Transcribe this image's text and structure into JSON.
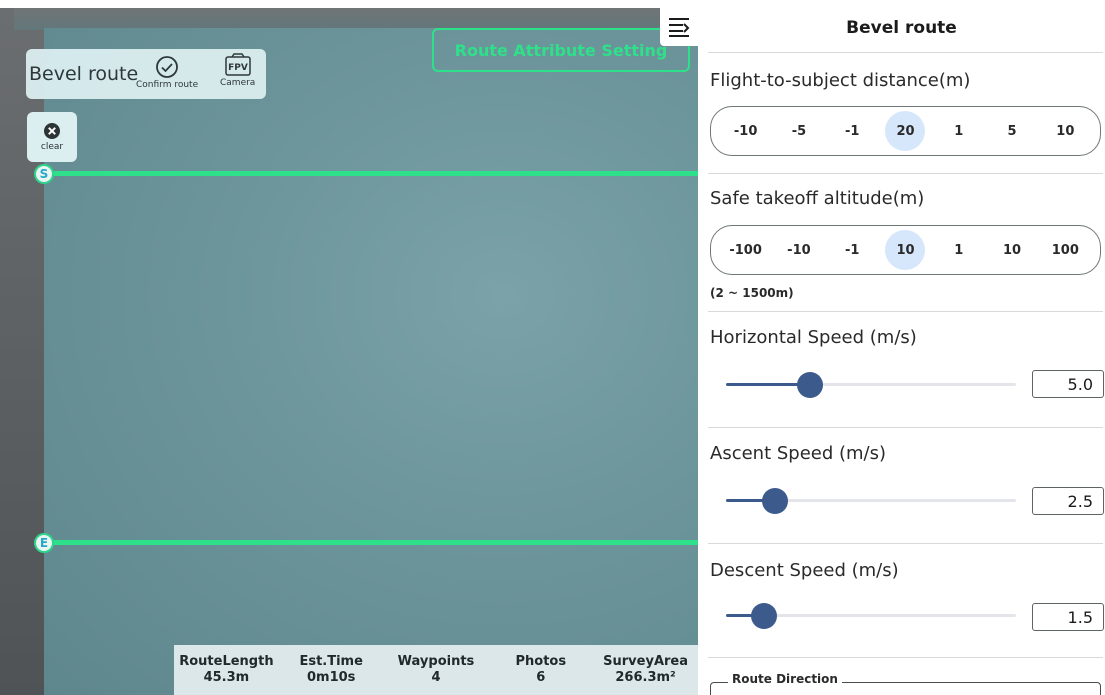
{
  "map": {
    "route_title": "Bevel route",
    "confirm_label": "Confirm route",
    "camera_label": "Camera",
    "camera_icon_text": "FPV",
    "clear_label": "clear",
    "attr_button": "Route Attribute Setting",
    "start_marker": "S",
    "end_marker": "E",
    "route_color": "#2fe08a"
  },
  "stats": [
    {
      "label": "RouteLength",
      "value": "45.3m"
    },
    {
      "label": "Est.Time",
      "value": "0m10s"
    },
    {
      "label": "Waypoints",
      "value": "4"
    },
    {
      "label": "Photos",
      "value": "6"
    },
    {
      "label": "SurveyArea",
      "value": "266.3m²"
    }
  ],
  "panel": {
    "title": "Bevel route",
    "distance": {
      "label": "Flight-to-subject distance(m)",
      "steps": [
        "-10",
        "-5",
        "-1",
        "20",
        "1",
        "5",
        "10"
      ],
      "current": "20"
    },
    "takeoff": {
      "label": "Safe takeoff altitude(m)",
      "steps": [
        "-100",
        "-10",
        "-1",
        "10",
        "1",
        "10",
        "100"
      ],
      "current": "10",
      "range": "(2 ~ 1500m)"
    },
    "horizontal": {
      "label": "Horizontal Speed (m/s)",
      "value": "5.0",
      "level": 0.29
    },
    "ascent": {
      "label": "Ascent Speed (m/s)",
      "value": "2.5",
      "level": 0.17
    },
    "descent": {
      "label": "Descent Speed (m/s)",
      "value": "1.5",
      "level": 0.13
    },
    "direction_label": "Route Direction",
    "accent_color": "#3c5a8c"
  }
}
